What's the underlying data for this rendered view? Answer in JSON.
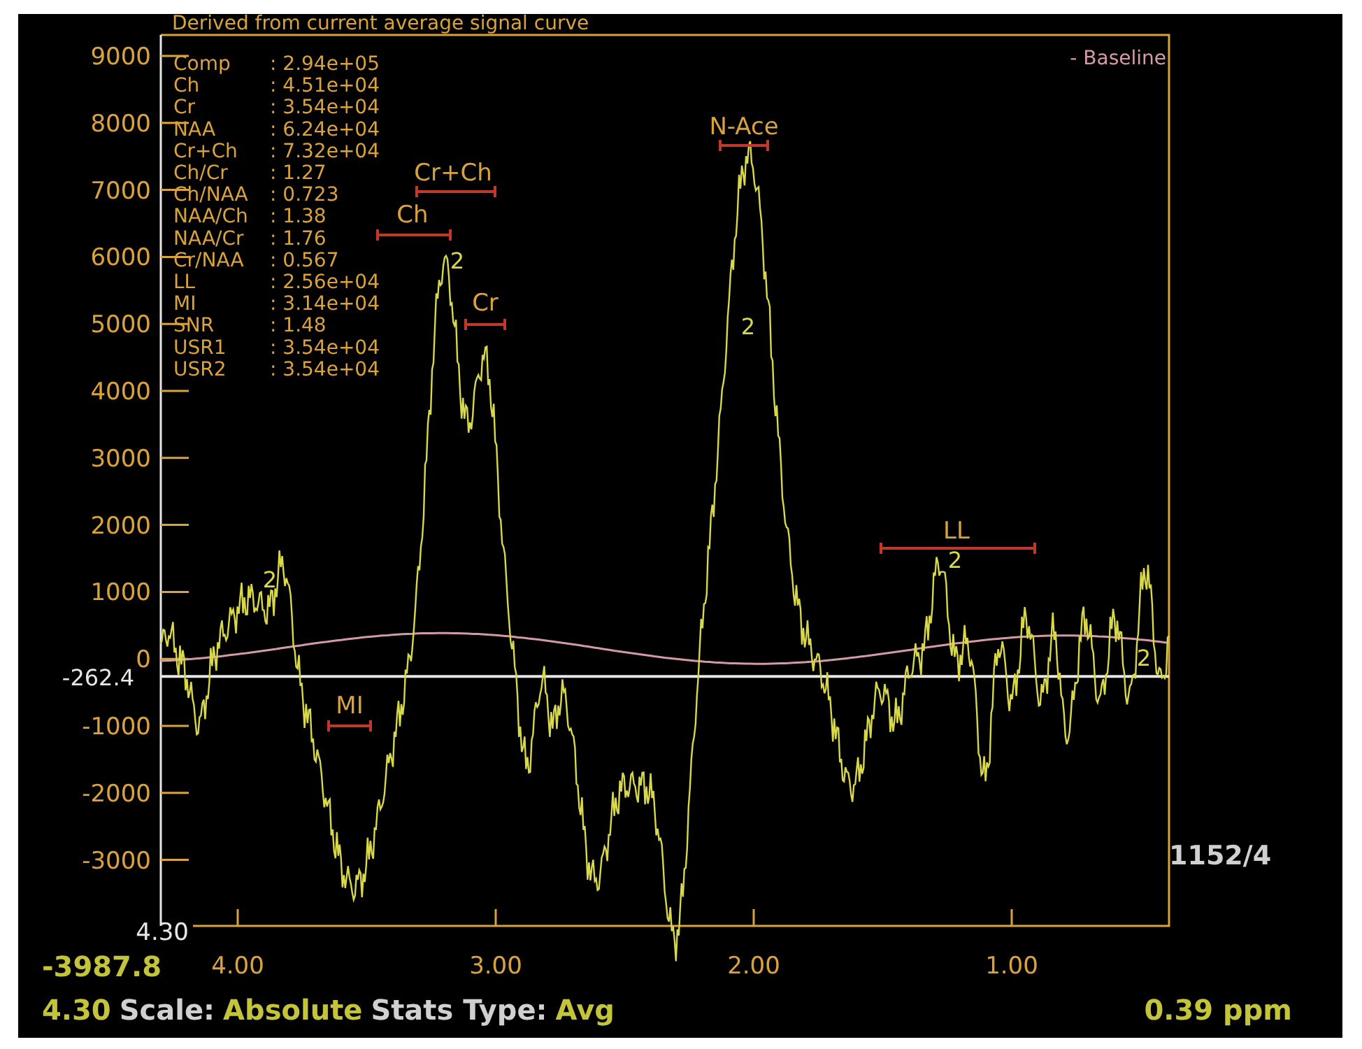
{
  "title": "Derived from current average signal curve",
  "legend": "- Baseline",
  "stats": [
    {
      "label": "Comp",
      "value": ": 2.94e+05"
    },
    {
      "label": "Ch",
      "value": ": 4.51e+04"
    },
    {
      "label": "Cr",
      "value": ": 3.54e+04"
    },
    {
      "label": "NAA",
      "value": ": 6.24e+04"
    },
    {
      "label": "Cr+Ch",
      "value": ": 7.32e+04"
    },
    {
      "label": "Ch/Cr",
      "value": ": 1.27"
    },
    {
      "label": "Ch/NAA",
      "value": ": 0.723"
    },
    {
      "label": "NAA/Ch",
      "value": ": 1.38"
    },
    {
      "label": "NAA/Cr",
      "value": ": 1.76"
    },
    {
      "label": "Cr/NAA",
      "value": ": 0.567"
    },
    {
      "label": "LL",
      "value": ": 2.56e+04"
    },
    {
      "label": "MI",
      "value": ": 3.14e+04"
    },
    {
      "label": "SNR",
      "value": ": 1.48"
    },
    {
      "label": "USR1",
      "value": ": 3.54e+04"
    },
    {
      "label": "USR2",
      "value": ": 3.54e+04"
    }
  ],
  "y_ticks": [
    "9000",
    "8000",
    "7000",
    "6000",
    "5000",
    "4000",
    "3000",
    "2000",
    "1000",
    "0",
    "-1000",
    "-2000",
    "-3000"
  ],
  "x_ticks": [
    "4.00",
    "3.00",
    "2.00",
    "1.00"
  ],
  "x_start": "4.30",
  "cursor_value": "-262.4",
  "min_value": "-3987.8",
  "count": "1152/4",
  "peaks": [
    {
      "label": "N-Ace"
    },
    {
      "label": "Cr+Ch"
    },
    {
      "label": "Ch"
    },
    {
      "label": "Cr"
    },
    {
      "label": "LL"
    },
    {
      "label": "MI"
    }
  ],
  "markers": [
    "2",
    "2",
    "2",
    "2",
    "2"
  ],
  "status": {
    "start": "4.30",
    "scale_label": "Scale:",
    "scale": "Absolute",
    "stats_label": "Stats Type:",
    "stats_type": "Avg",
    "end": "0.39 ppm"
  }
}
